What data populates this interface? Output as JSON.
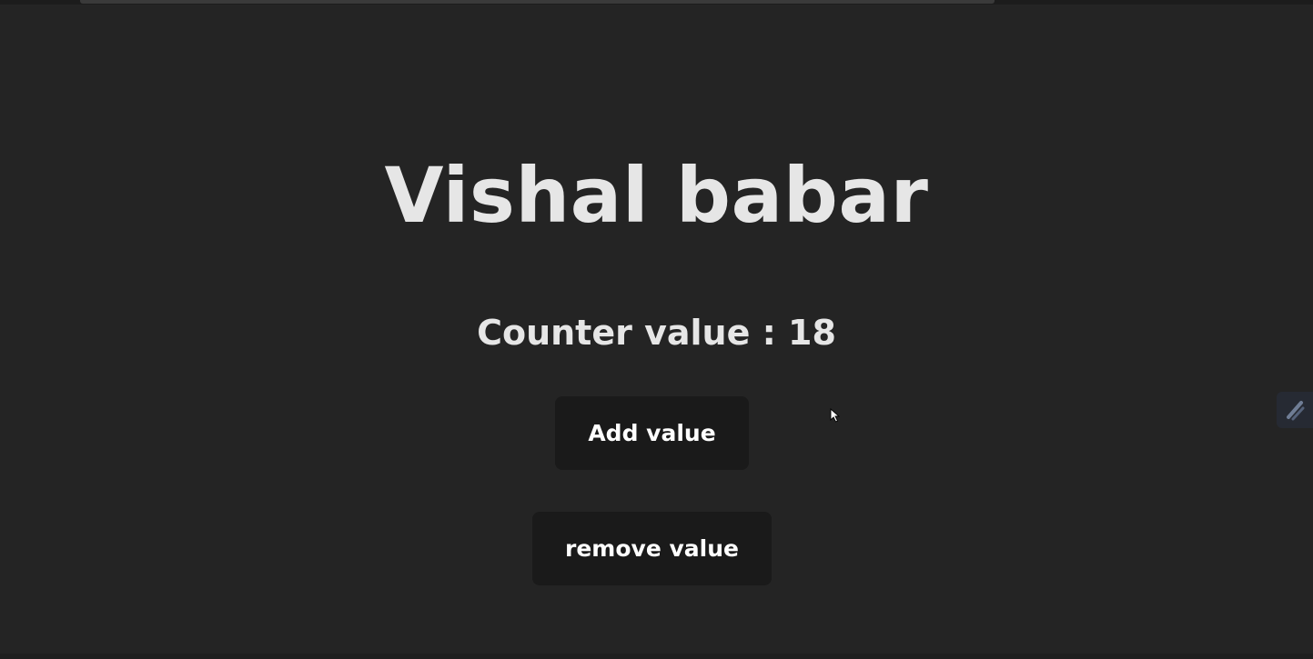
{
  "app": {
    "heading": "Vishal babar",
    "counter_label": "Counter value : ",
    "counter_value": "18"
  },
  "buttons": {
    "add_label": "Add value",
    "remove_label": "remove value"
  },
  "overlay": {
    "side_widget_icon": "extension-pen-icon",
    "cursor_icon": "mouse-pointer-icon"
  },
  "colors": {
    "background": "#242424",
    "text": "#e6e6e6",
    "button_bg": "#1a1a1a",
    "button_text": "#ffffff"
  }
}
